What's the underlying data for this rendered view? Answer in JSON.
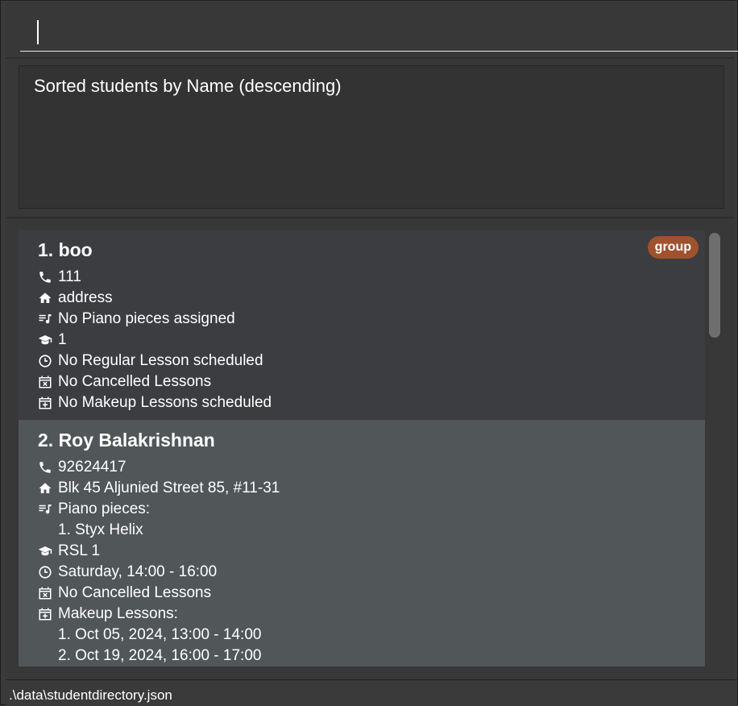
{
  "command": {
    "value": ""
  },
  "result": {
    "message": "Sorted students by Name (descending)"
  },
  "students": [
    {
      "name": "1. boo",
      "tag": "group",
      "phone": "111",
      "address": "address",
      "pieces": "No Piano pieces assigned",
      "grade": "1",
      "regular_lesson": "No Regular Lesson scheduled",
      "cancelled": "No Cancelled Lessons",
      "makeup": "No Makeup Lessons scheduled"
    },
    {
      "name": "2. Roy Balakrishnan",
      "phone": "92624417",
      "address": "Blk 45 Aljunied Street 85, #11-31",
      "pieces": "Piano pieces:",
      "piece_items": [
        "1. Styx Helix"
      ],
      "grade": "RSL 1",
      "regular_lesson": "Saturday, 14:00 - 16:00",
      "cancelled": "No Cancelled Lessons",
      "makeup": "Makeup Lessons:",
      "makeup_items": [
        "1. Oct 05, 2024, 13:00 - 14:00",
        "2. Oct 19, 2024, 16:00 - 17:00"
      ]
    }
  ],
  "status": {
    "file_path": ".\\data\\studentdirectory.json"
  },
  "colors": {
    "background": "#3a3a3a",
    "card_odd": "#3b3d40",
    "card_even": "#515658",
    "tag": "#a0512d"
  },
  "icons": [
    "phone-icon",
    "home-icon",
    "music-list-icon",
    "graduation-cap-icon",
    "clock-icon",
    "calendar-x-icon",
    "calendar-plus-icon"
  ]
}
